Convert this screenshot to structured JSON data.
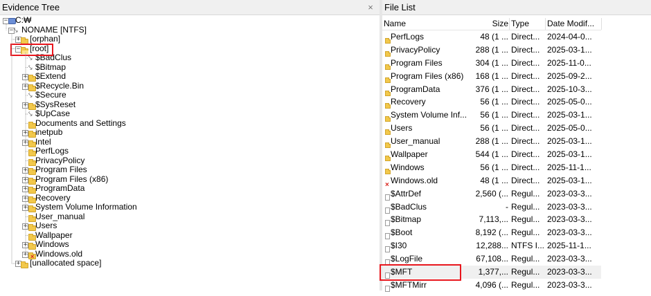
{
  "left": {
    "title": "Evidence Tree",
    "close": "×",
    "tree": [
      {
        "label": "C:₩",
        "icon": "drive",
        "level": 0,
        "expander": "−"
      },
      {
        "label": "NONAME [NTFS]",
        "icon": "fs",
        "level": 1,
        "expander": "−"
      },
      {
        "label": "[orphan]",
        "icon": "folder",
        "level": 2,
        "expander": "+"
      },
      {
        "label": "[root]",
        "icon": "folder-open",
        "level": 2,
        "expander": "−"
      },
      {
        "label": "$BadClus",
        "icon": "fs",
        "level": 3,
        "expander": ""
      },
      {
        "label": "$Bitmap",
        "icon": "fs",
        "level": 3,
        "expander": ""
      },
      {
        "label": "$Extend",
        "icon": "folder",
        "level": 3,
        "expander": "+"
      },
      {
        "label": "$Recycle.Bin",
        "icon": "folder",
        "level": 3,
        "expander": "+"
      },
      {
        "label": "$Secure",
        "icon": "fs",
        "level": 3,
        "expander": ""
      },
      {
        "label": "$SysReset",
        "icon": "folder",
        "level": 3,
        "expander": "+"
      },
      {
        "label": "$UpCase",
        "icon": "fs",
        "level": 3,
        "expander": ""
      },
      {
        "label": "Documents and Settings",
        "icon": "folder",
        "level": 3,
        "expander": ""
      },
      {
        "label": "inetpub",
        "icon": "folder",
        "level": 3,
        "expander": "+"
      },
      {
        "label": "Intel",
        "icon": "folder",
        "level": 3,
        "expander": "+"
      },
      {
        "label": "PerfLogs",
        "icon": "folder",
        "level": 3,
        "expander": ""
      },
      {
        "label": "PrivacyPolicy",
        "icon": "folder",
        "level": 3,
        "expander": ""
      },
      {
        "label": "Program Files",
        "icon": "folder",
        "level": 3,
        "expander": "+"
      },
      {
        "label": "Program Files (x86)",
        "icon": "folder",
        "level": 3,
        "expander": "+"
      },
      {
        "label": "ProgramData",
        "icon": "folder",
        "level": 3,
        "expander": "+"
      },
      {
        "label": "Recovery",
        "icon": "folder",
        "level": 3,
        "expander": "+"
      },
      {
        "label": "System Volume Information",
        "icon": "folder",
        "level": 3,
        "expander": "+"
      },
      {
        "label": "User_manual",
        "icon": "folder",
        "level": 3,
        "expander": ""
      },
      {
        "label": "Users",
        "icon": "folder",
        "level": 3,
        "expander": "+"
      },
      {
        "label": "Wallpaper",
        "icon": "folder",
        "level": 3,
        "expander": ""
      },
      {
        "label": "Windows",
        "icon": "folder",
        "level": 3,
        "expander": "+"
      },
      {
        "label": "Windows.old",
        "icon": "folder-deleted",
        "level": 3,
        "expander": "+"
      },
      {
        "label": "[unallocated space]",
        "icon": "folder",
        "level": 2,
        "expander": "+"
      }
    ]
  },
  "right": {
    "title": "File List",
    "columns": {
      "name": "Name",
      "size": "Size",
      "type": "Type",
      "date": "Date Modif..."
    },
    "rows": [
      {
        "icon": "folder",
        "name": "PerfLogs",
        "size": "48 (1 ...",
        "type": "Direct...",
        "date": "2024-04-0..."
      },
      {
        "icon": "folder",
        "name": "PrivacyPolicy",
        "size": "288 (1 ...",
        "type": "Direct...",
        "date": "2025-03-1..."
      },
      {
        "icon": "folder",
        "name": "Program Files",
        "size": "304 (1 ...",
        "type": "Direct...",
        "date": "2025-11-0..."
      },
      {
        "icon": "folder",
        "name": "Program Files (x86)",
        "size": "168 (1 ...",
        "type": "Direct...",
        "date": "2025-09-2..."
      },
      {
        "icon": "folder",
        "name": "ProgramData",
        "size": "376 (1 ...",
        "type": "Direct...",
        "date": "2025-10-3..."
      },
      {
        "icon": "folder",
        "name": "Recovery",
        "size": "56 (1 ...",
        "type": "Direct...",
        "date": "2025-05-0..."
      },
      {
        "icon": "folder",
        "name": "System Volume Inf...",
        "size": "56 (1 ...",
        "type": "Direct...",
        "date": "2025-03-1..."
      },
      {
        "icon": "folder",
        "name": "Users",
        "size": "56 (1 ...",
        "type": "Direct...",
        "date": "2025-05-0..."
      },
      {
        "icon": "folder",
        "name": "User_manual",
        "size": "288 (1 ...",
        "type": "Direct...",
        "date": "2025-03-1..."
      },
      {
        "icon": "folder",
        "name": "Wallpaper",
        "size": "544 (1 ...",
        "type": "Direct...",
        "date": "2025-03-1..."
      },
      {
        "icon": "folder",
        "name": "Windows",
        "size": "56 (1 ...",
        "type": "Direct...",
        "date": "2025-11-1..."
      },
      {
        "icon": "deleted",
        "name": "Windows.old",
        "size": "48 (1 ...",
        "type": "Direct...",
        "date": "2025-03-1..."
      },
      {
        "icon": "file",
        "name": "$AttrDef",
        "size": "2,560 (...",
        "type": "Regul...",
        "date": "2023-03-3..."
      },
      {
        "icon": "file",
        "name": "$BadClus",
        "size": "-",
        "type": "Regul...",
        "date": "2023-03-3..."
      },
      {
        "icon": "file",
        "name": "$Bitmap",
        "size": "7,113,...",
        "type": "Regul...",
        "date": "2023-03-3..."
      },
      {
        "icon": "file",
        "name": "$Boot",
        "size": "8,192 (...",
        "type": "Regul...",
        "date": "2023-03-3..."
      },
      {
        "icon": "file",
        "name": "$I30",
        "size": "12,288...",
        "type": "NTFS I...",
        "date": "2025-11-1..."
      },
      {
        "icon": "file",
        "name": "$LogFile",
        "size": "67,108...",
        "type": "Regul...",
        "date": "2023-03-3..."
      },
      {
        "icon": "file",
        "name": "$MFT",
        "size": "1,377,...",
        "type": "Regul...",
        "date": "2023-03-3...",
        "selected": true
      },
      {
        "icon": "file",
        "name": "$MFTMirr",
        "size": "4,096 (...",
        "type": "Regul...",
        "date": "2023-03-3..."
      }
    ]
  },
  "highlight_color": "#e8161d"
}
